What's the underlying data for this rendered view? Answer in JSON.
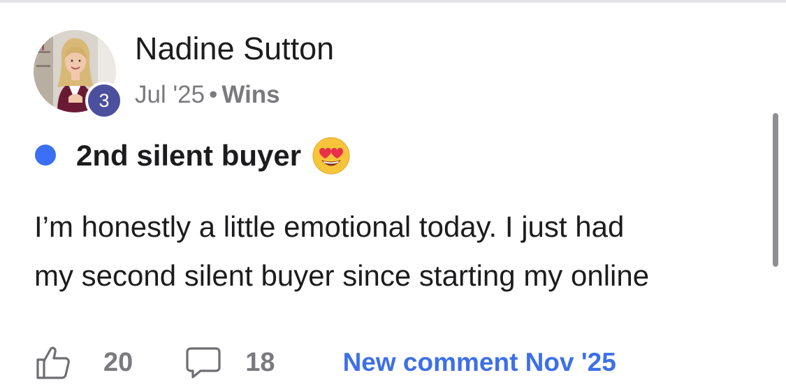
{
  "post": {
    "author": {
      "name": "Nadine Sutton",
      "level": "3"
    },
    "meta": {
      "date": "Jul '25",
      "separator": "•",
      "category": "Wins"
    },
    "title": "2nd silent buyer",
    "title_emoji": "heart-eyes-emoji-icon",
    "body_lines": [
      "I’m honestly a little emotional today. I just had",
      "my second silent buyer since starting my online"
    ],
    "likes_count": "20",
    "comments_count": "18",
    "new_comment_label": "New comment Nov '25"
  },
  "colors": {
    "accent_blue": "#3d6fe8",
    "unread_dot": "#3b6ff5",
    "level_badge": "#4a4f9e",
    "muted_text": "#7a7a7e"
  },
  "icons": {
    "like": "thumbs-up-icon",
    "comment": "comment-bubble-icon"
  }
}
